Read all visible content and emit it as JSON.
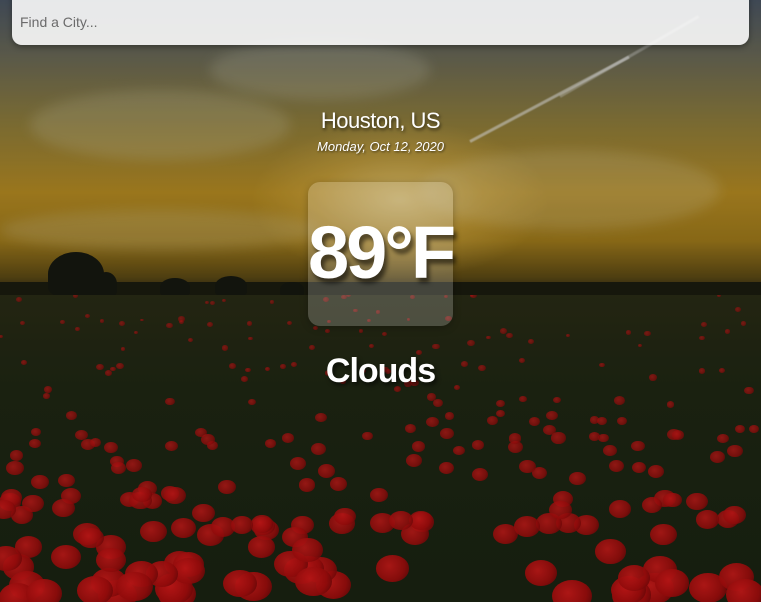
{
  "search": {
    "placeholder": "Find a City...",
    "value": ""
  },
  "location": {
    "city_country": "Houston, US",
    "date": "Monday, Oct 12, 2020"
  },
  "weather": {
    "temperature": "89°F",
    "condition": "Clouds"
  },
  "background": {
    "scene": "sunset sky over red poppy field",
    "colors": {
      "sky_gold": "#b58b22",
      "poppy_red": "#c81414",
      "field_dark": "#1a2412"
    }
  }
}
